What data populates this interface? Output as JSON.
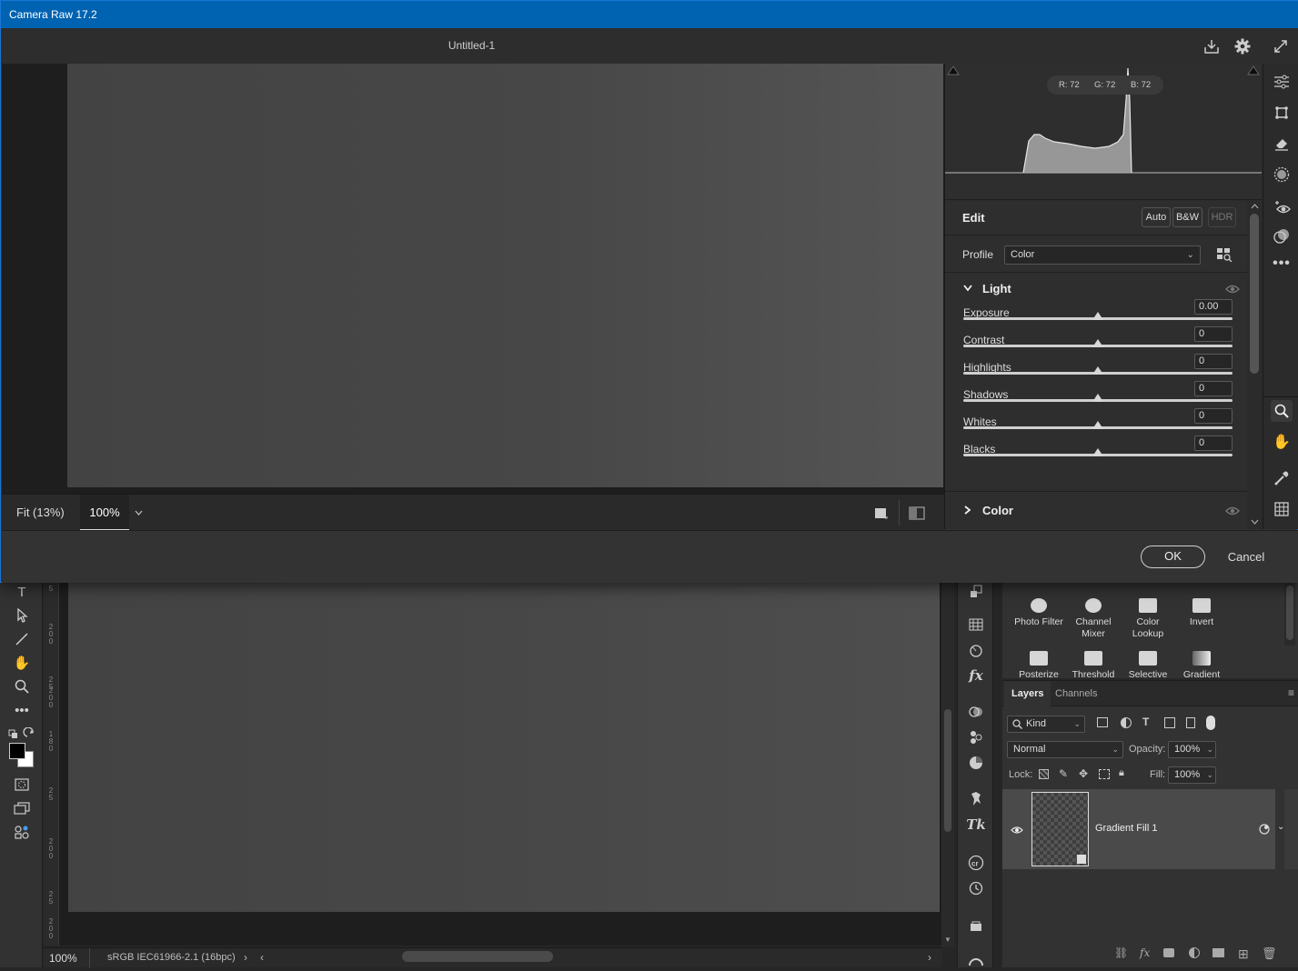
{
  "photoshop": {
    "ruler_marks": [
      "5",
      "2\n0\n0",
      "2\n5",
      "2\n0\n0",
      "1\n8\n0",
      "2\n5",
      "2\n0\n0",
      "2\n5",
      "2\n0\n0"
    ],
    "status": {
      "zoom": "100%",
      "profile": "sRGB IEC61966-2.1 (16bpc)"
    },
    "adjustments": [
      {
        "label": "Photo Filter"
      },
      {
        "label": "Channel\nMixer"
      },
      {
        "label": "Color\nLookup"
      },
      {
        "label": "Invert"
      },
      {
        "label": "Posterize"
      },
      {
        "label": "Threshold"
      },
      {
        "label": "Selective"
      },
      {
        "label": "Gradient"
      }
    ],
    "layers_panel": {
      "tabs": [
        "Layers",
        "Channels"
      ],
      "filter_kind": "Kind",
      "blend_mode": "Normal",
      "opacity_label": "Opacity:",
      "opacity_value": "100%",
      "lock_label": "Lock:",
      "fill_label": "Fill:",
      "fill_value": "100%",
      "layers": [
        {
          "name": "Gradient Fill 1"
        }
      ]
    }
  },
  "camera_raw": {
    "window_title": "Camera Raw 17.2",
    "document_title": "Untitled-1",
    "histogram": {
      "r_label": "R: 72",
      "g_label": "G: 72",
      "b_label": "B: 72"
    },
    "preview_footer": {
      "fit_label": "Fit (13%)",
      "zoom_value": "100%"
    },
    "edit": {
      "title": "Edit",
      "auto_label": "Auto",
      "bw_label": "B&W",
      "hdr_label": "HDR",
      "profile_label": "Profile",
      "profile_value": "Color",
      "light_section": "Light",
      "color_section": "Color",
      "sliders": [
        {
          "label": "Exposure",
          "value": "0.00",
          "position": 0.5
        },
        {
          "label": "Contrast",
          "value": "0",
          "position": 0.5
        },
        {
          "label": "Highlights",
          "value": "0",
          "position": 0.5
        },
        {
          "label": "Shadows",
          "value": "0",
          "position": 0.5
        },
        {
          "label": "Whites",
          "value": "0",
          "position": 0.5
        },
        {
          "label": "Blacks",
          "value": "0",
          "position": 0.5
        }
      ]
    },
    "ok_label": "OK",
    "cancel_label": "Cancel",
    "colors": {
      "titlebar": "#0063b1",
      "accent_border": "#1a74d4"
    }
  }
}
